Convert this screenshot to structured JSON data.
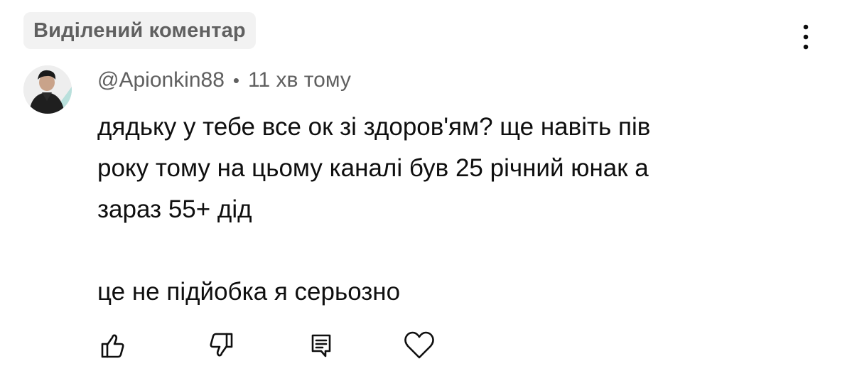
{
  "badge": {
    "label": "Виділений коментар"
  },
  "comment": {
    "author": "@Apionkin88",
    "separator": "•",
    "time": "11 хв тому",
    "lines": [
      "дядьку у тебе все ок зі здоров'ям? ще навіть пів",
      "року тому на цьому каналі був 25 річний юнак а",
      "зараз 55+ дід",
      "",
      "це не підйобка я серьозно"
    ]
  },
  "icons": {
    "menu": "more-vertical-icon",
    "like": "thumbs-up-icon",
    "dislike": "thumbs-down-icon",
    "reply": "comment-reply-icon",
    "heart": "heart-icon"
  },
  "colors": {
    "text": "#0f0f0f",
    "secondary": "#606060",
    "badge_bg": "#f2f2f2"
  }
}
